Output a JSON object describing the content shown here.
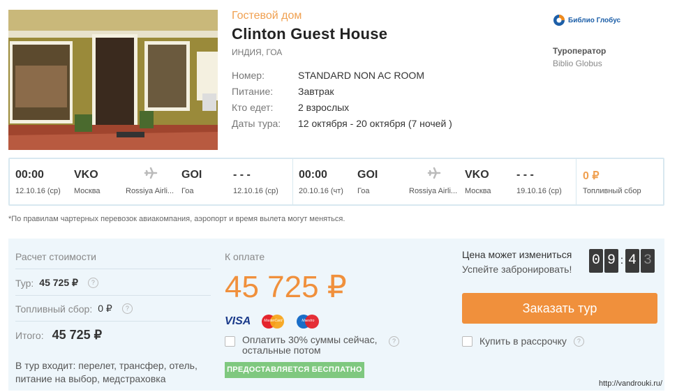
{
  "hotel": {
    "type_label": "Гостевой дом",
    "name": "Clinton Guest House",
    "location": "ИНДИЯ, ГОА",
    "details": [
      {
        "label": "Номер:",
        "value": "STANDARD NON AC ROOM"
      },
      {
        "label": "Питание:",
        "value": "Завтрак"
      },
      {
        "label": "Кто едет:",
        "value": "2 взрослых"
      },
      {
        "label": "Даты тура:",
        "value": "12 октября - 20 октября (7 ночей )"
      }
    ]
  },
  "operator": {
    "logo_text": "Библио Глобус",
    "label": "Туроператор",
    "name": "Biblio Globus"
  },
  "flights": [
    {
      "dep_time": "00:00",
      "dep_date": "12.10.16 (ср)",
      "from_code": "VKO",
      "from_city": "Москва",
      "airline": "Rossiya Airli...",
      "to_code": "GOI",
      "to_city": "Гоа",
      "arr_time": "- - -",
      "arr_date": "12.10.16 (ср)"
    },
    {
      "dep_time": "00:00",
      "dep_date": "20.10.16 (чт)",
      "from_code": "GOI",
      "from_city": "Гоа",
      "airline": "Rossiya Airli...",
      "to_code": "VKO",
      "to_city": "Москва",
      "arr_time": "- - -",
      "arr_date": "19.10.16 (ср)"
    }
  ],
  "fuel_box": {
    "value": "0 ₽",
    "label": "Топливный сбор"
  },
  "note": "*По правилам чартерных перевозок авиакомпания, аэропорт и время вылета могут меняться.",
  "calc": {
    "title": "Расчет стоимости",
    "tour_label": "Тур:",
    "tour_value": "45 725 ₽",
    "fuel_label": "Топливный сбор:",
    "fuel_value": "0 ₽",
    "total_label": "Итого:",
    "total_value": "45 725 ₽",
    "includes": "В тур входит: перелет, трансфер, отель, питание на выбор, медстраховка"
  },
  "payment": {
    "label": "К оплате",
    "amount": "45 725 ₽",
    "card_visa": "VISA",
    "card_mastercard": "MasterCard",
    "card_maestro": "Maestro",
    "partial_option": "Оплатить 30% суммы сейчас, остальные потом",
    "free_badge": "ПРЕДОСТАВЛЯЕТСЯ БЕСПЛАТНО"
  },
  "timer": {
    "line1": "Цена может измениться",
    "line2": "Успейте забронировать!",
    "digits": [
      "0",
      "9",
      "4",
      "3"
    ]
  },
  "order_button": "Заказать тур",
  "installment_option": "Купить в рассрочку",
  "info_mark": "?",
  "watermark": "http://vandrouki.ru/",
  "colors": {
    "accent_orange": "#f0903c",
    "price_orange": "#f0a050",
    "badge_green": "#7fc87f",
    "panel_bg": "#eef6fb"
  }
}
